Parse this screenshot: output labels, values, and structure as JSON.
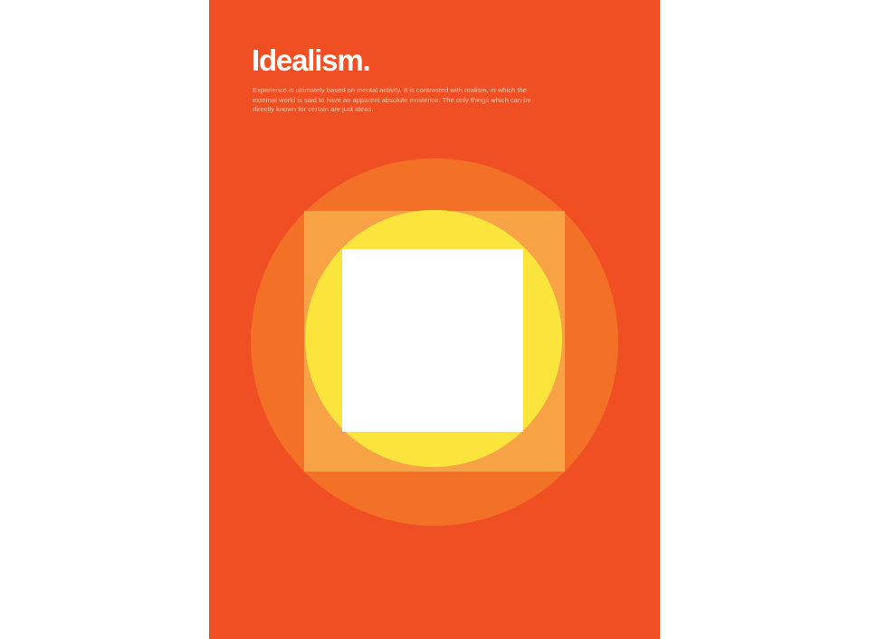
{
  "poster": {
    "title": "Idealism.",
    "body": "Experience is ultimately based on mental activity. It is contrasted with realism, in which the external world is said to have an apparent absolute existence. The only things which can be directly known for certain are just ideas."
  },
  "colors": {
    "page_background": "#ffffff",
    "poster_background": "#f04f24",
    "outer_circle": "#f27127",
    "middle_square": "#f8a246",
    "inner_circle": "#fbe43c",
    "center_square": "#ffffff",
    "title_text": "#ffffff",
    "body_text": "#f7c7a8"
  },
  "icons": [
    "outer-circle",
    "middle-square",
    "inner-circle",
    "center-square"
  ]
}
